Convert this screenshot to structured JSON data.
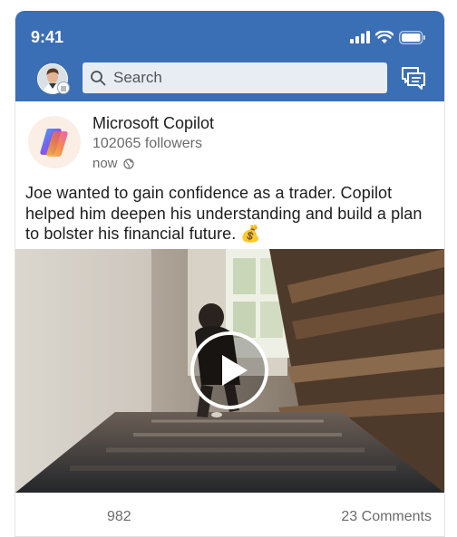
{
  "status_bar": {
    "time": "9:41"
  },
  "nav": {
    "search_placeholder": "Search"
  },
  "post": {
    "author": "Microsoft Copilot",
    "followers": "102065 followers",
    "time": "now",
    "text": "Joe wanted to gain confidence as a trader. Copilot helped him deepen his understanding and build a plan to bolster his financial future. 💰",
    "reactions": "982",
    "comments": "23 Comments"
  },
  "colors": {
    "brand_blue": "#3a6fb5"
  },
  "icons": [
    "signal-icon",
    "wifi-icon",
    "battery-icon",
    "search-icon",
    "messaging-icon",
    "globe-icon",
    "play-icon"
  ]
}
